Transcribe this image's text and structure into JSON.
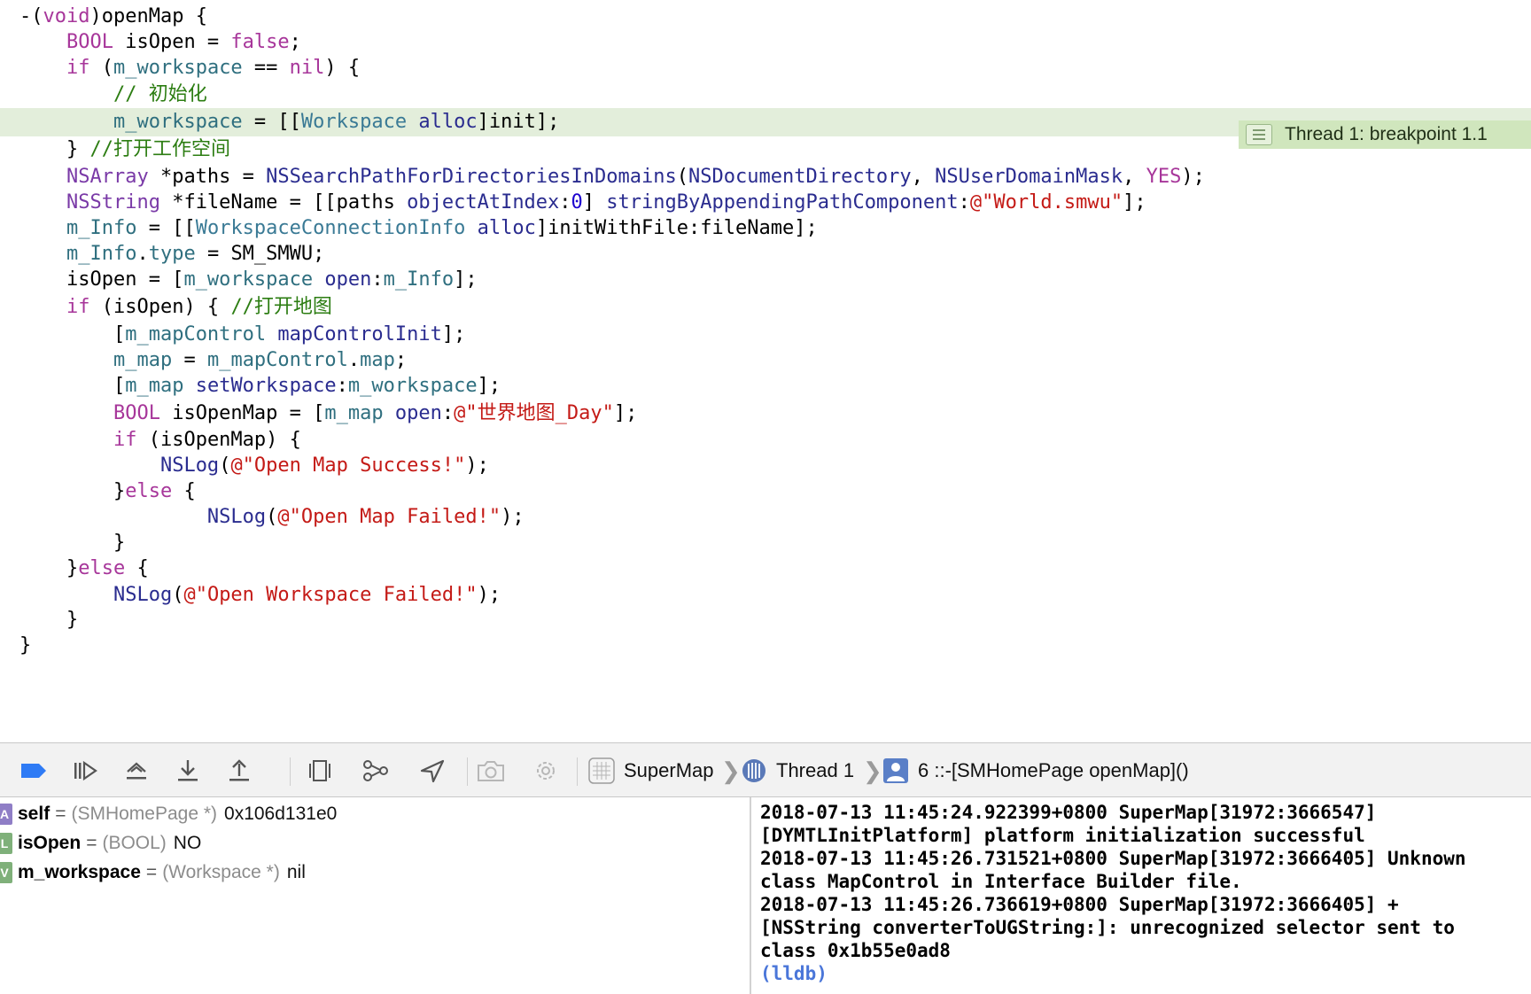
{
  "editor": {
    "breakpoint_label": "Thread 1: breakpoint 1.1",
    "lines": [
      [
        [
          "-(",
          "plain"
        ],
        [
          "void",
          "kw"
        ],
        [
          ")openMap {",
          "plain"
        ]
      ],
      [
        [
          "    ",
          "plain"
        ],
        [
          "BOOL",
          "kw"
        ],
        [
          " isOpen = ",
          "plain"
        ],
        [
          "false",
          "kw"
        ],
        [
          ";",
          "plain"
        ]
      ],
      [
        [
          "    ",
          "plain"
        ],
        [
          "if",
          "kw"
        ],
        [
          " (",
          "plain"
        ],
        [
          "m_workspace",
          "var"
        ],
        [
          " == ",
          "plain"
        ],
        [
          "nil",
          "kw"
        ],
        [
          ") {",
          "plain"
        ]
      ],
      [
        [
          "        ",
          "plain"
        ],
        [
          "// 初始化",
          "cmt"
        ]
      ],
      [
        [
          "        ",
          "plain"
        ],
        [
          "m_workspace",
          "var"
        ],
        [
          " = [[",
          "plain"
        ],
        [
          "Workspace",
          "cls"
        ],
        [
          " ",
          "plain"
        ],
        [
          "alloc",
          "fn"
        ],
        [
          "]init];",
          "plain"
        ]
      ],
      [
        [
          "    } ",
          "plain"
        ],
        [
          "//打开工作空间",
          "cmt"
        ]
      ],
      [
        [
          "    ",
          "plain"
        ],
        [
          "NSArray",
          "type"
        ],
        [
          " *paths = ",
          "plain"
        ],
        [
          "NSSearchPathForDirectoriesInDomains",
          "fn"
        ],
        [
          "(",
          "plain"
        ],
        [
          "NSDocumentDirectory",
          "fn"
        ],
        [
          ", ",
          "plain"
        ],
        [
          "NSUserDomainMask",
          "fn"
        ],
        [
          ", ",
          "plain"
        ],
        [
          "YES",
          "kw"
        ],
        [
          ");",
          "plain"
        ]
      ],
      [
        [
          "    ",
          "plain"
        ],
        [
          "NSString",
          "type"
        ],
        [
          " *fileName = [[paths ",
          "plain"
        ],
        [
          "objectAtIndex",
          "fn"
        ],
        [
          ":",
          "plain"
        ],
        [
          "0",
          "num"
        ],
        [
          "] ",
          "plain"
        ],
        [
          "stringByAppendingPathComponent",
          "fn"
        ],
        [
          ":",
          "plain"
        ],
        [
          "@\"World.smwu\"",
          "str"
        ],
        [
          "];",
          "plain"
        ]
      ],
      [
        [
          "    ",
          "plain"
        ],
        [
          "m_Info",
          "var"
        ],
        [
          " = [[",
          "plain"
        ],
        [
          "WorkspaceConnectionInfo",
          "cls"
        ],
        [
          " ",
          "plain"
        ],
        [
          "alloc",
          "fn"
        ],
        [
          "]initWithFile:fileName];",
          "plain"
        ]
      ],
      [
        [
          "    ",
          "plain"
        ],
        [
          "m_Info",
          "var"
        ],
        [
          ".",
          "plain"
        ],
        [
          "type",
          "var"
        ],
        [
          " = SM_SMWU;",
          "plain"
        ]
      ],
      [
        [
          "    isOpen = [",
          "plain"
        ],
        [
          "m_workspace",
          "var"
        ],
        [
          " ",
          "plain"
        ],
        [
          "open",
          "fn"
        ],
        [
          ":",
          "plain"
        ],
        [
          "m_Info",
          "var"
        ],
        [
          "];",
          "plain"
        ]
      ],
      [
        [
          "    ",
          "plain"
        ],
        [
          "if",
          "kw"
        ],
        [
          " (isOpen) { ",
          "plain"
        ],
        [
          "//打开地图",
          "cmt"
        ]
      ],
      [
        [
          "        [",
          "plain"
        ],
        [
          "m_mapControl",
          "var"
        ],
        [
          " ",
          "plain"
        ],
        [
          "mapControlInit",
          "fn"
        ],
        [
          "];",
          "plain"
        ]
      ],
      [
        [
          "        ",
          "plain"
        ],
        [
          "m_map",
          "var"
        ],
        [
          " = ",
          "plain"
        ],
        [
          "m_mapControl",
          "var"
        ],
        [
          ".",
          "plain"
        ],
        [
          "map",
          "var"
        ],
        [
          ";",
          "plain"
        ]
      ],
      [
        [
          "        [",
          "plain"
        ],
        [
          "m_map",
          "var"
        ],
        [
          " ",
          "plain"
        ],
        [
          "setWorkspace",
          "fn"
        ],
        [
          ":",
          "plain"
        ],
        [
          "m_workspace",
          "var"
        ],
        [
          "];",
          "plain"
        ]
      ],
      [
        [
          "        ",
          "plain"
        ],
        [
          "BOOL",
          "kw"
        ],
        [
          " isOpenMap = [",
          "plain"
        ],
        [
          "m_map",
          "var"
        ],
        [
          " ",
          "plain"
        ],
        [
          "open",
          "fn"
        ],
        [
          ":",
          "plain"
        ],
        [
          "@\"世界地图_Day\"",
          "str"
        ],
        [
          "];",
          "plain"
        ]
      ],
      [
        [
          "        ",
          "plain"
        ],
        [
          "if",
          "kw"
        ],
        [
          " (isOpenMap) {",
          "plain"
        ]
      ],
      [
        [
          "            ",
          "plain"
        ],
        [
          "NSLog",
          "fn"
        ],
        [
          "(",
          "plain"
        ],
        [
          "@\"Open Map Success!\"",
          "str"
        ],
        [
          ");",
          "plain"
        ]
      ],
      [
        [
          "        }",
          "plain"
        ],
        [
          "else",
          "kw"
        ],
        [
          " {",
          "plain"
        ]
      ],
      [
        [
          "                ",
          "plain"
        ],
        [
          "NSLog",
          "fn"
        ],
        [
          "(",
          "plain"
        ],
        [
          "@\"Open Map Failed!\"",
          "str"
        ],
        [
          ");",
          "plain"
        ]
      ],
      [
        [
          "        }",
          "plain"
        ]
      ],
      [
        [
          "    }",
          "plain"
        ],
        [
          "else",
          "kw"
        ],
        [
          " {",
          "plain"
        ]
      ],
      [
        [
          "        ",
          "plain"
        ],
        [
          "NSLog",
          "fn"
        ],
        [
          "(",
          "plain"
        ],
        [
          "@\"Open Workspace Failed!\"",
          "str"
        ],
        [
          ");",
          "plain"
        ]
      ],
      [
        [
          "    }",
          "plain"
        ]
      ],
      [
        [
          "}",
          "plain"
        ]
      ]
    ],
    "highlighted_line_index": 4
  },
  "toolbar": {
    "buttons": [
      {
        "name": "breakpoints-toggle-icon",
        "state": "active"
      },
      {
        "name": "continue-icon"
      },
      {
        "name": "step-over-icon"
      },
      {
        "name": "step-into-icon"
      },
      {
        "name": "step-out-icon"
      },
      {
        "name": "view-hierarchy-icon"
      },
      {
        "name": "memory-graph-icon"
      },
      {
        "name": "simulate-location-icon"
      },
      {
        "name": "camera-icon",
        "state": "disabled"
      },
      {
        "name": "gear-icon",
        "state": "disabled"
      }
    ],
    "breadcrumb": {
      "app": "SuperMap",
      "thread": "Thread 1",
      "frame": "6 ::-[SMHomePage openMap]()"
    }
  },
  "variables": [
    {
      "badge": "A",
      "badge_color": "#8f7ec6",
      "name": "self",
      "type": "(SMHomePage *)",
      "value": "0x106d131e0"
    },
    {
      "badge": "L",
      "badge_color": "#7fb07a",
      "name": "isOpen",
      "type": "(BOOL)",
      "value": "NO"
    },
    {
      "badge": "V",
      "badge_color": "#7fb07a",
      "name": "m_workspace",
      "type": "(Workspace *)",
      "value": "nil"
    }
  ],
  "console": {
    "lines": [
      "2018-07-13 11:45:24.922399+0800 SuperMap[31972:3666547]",
      "[DYMTLInitPlatform] platform initialization successful",
      "2018-07-13 11:45:26.731521+0800 SuperMap[31972:3666405] Unknown",
      "class MapControl in Interface Builder file.",
      "2018-07-13 11:45:26.736619+0800 SuperMap[31972:3666405] +",
      "[NSString converterToUGString:]: unrecognized selector sent to",
      "class 0x1b55e0ad8"
    ],
    "prompt": "(lldb)"
  },
  "colors": {
    "breakpoint_line_bg": "#e3eedb",
    "breakpoint_badge_bg": "#d0e6bd",
    "keyword": "#a7369a",
    "string": "#c41a16",
    "comment": "#2c7d12",
    "accent_blue": "#2f7bf5"
  }
}
